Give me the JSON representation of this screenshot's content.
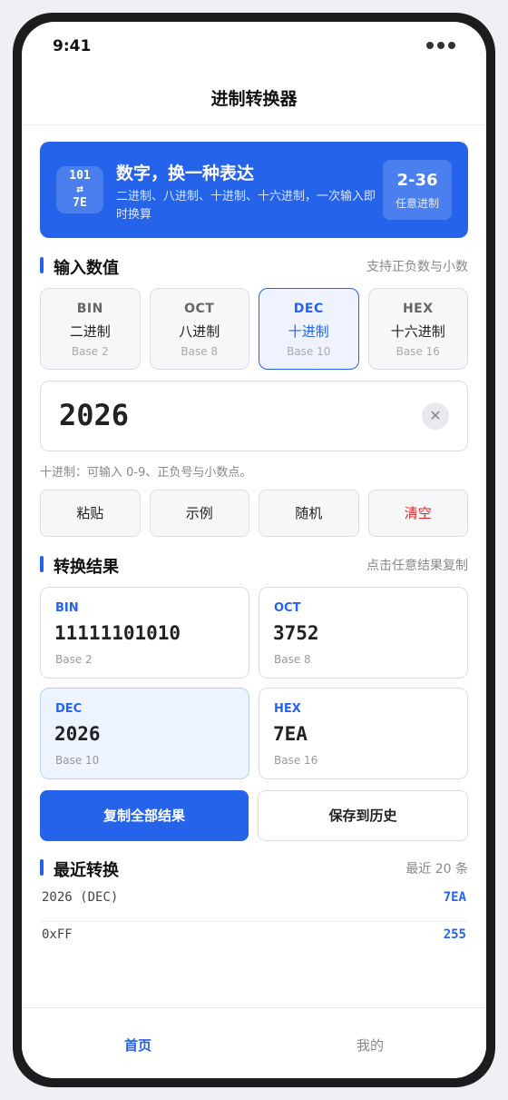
{
  "status": {
    "time": "9:41"
  },
  "navbar": {
    "title": "进制转换器"
  },
  "hero": {
    "badge": {
      "line1": "101",
      "line2": "⇄",
      "line3": "7E"
    },
    "headline": "数字，换一种表达",
    "subtitle": "二进制、八进制、十进制、十六进制，一次输入即时换算",
    "range": {
      "value": "2-36",
      "label": "任意进制"
    }
  },
  "input_section": {
    "title": "输入数值",
    "hint": "支持正负数与小数"
  },
  "bases": [
    {
      "code": "BIN",
      "name": "二进制",
      "base": "Base 2",
      "active": false
    },
    {
      "code": "OCT",
      "name": "八进制",
      "base": "Base 8",
      "active": false
    },
    {
      "code": "DEC",
      "name": "十进制",
      "base": "Base 10",
      "active": true
    },
    {
      "code": "HEX",
      "name": "十六进制",
      "base": "Base 16",
      "active": false
    }
  ],
  "input": {
    "value": "2026",
    "clear_icon": "close-icon"
  },
  "help_text": "十进制：可输入 0-9、正负号与小数点。",
  "actions": {
    "paste": "粘贴",
    "example": "示例",
    "random": "随机",
    "clear": "清空"
  },
  "results_section": {
    "title": "转换结果",
    "hint": "点击任意结果复制"
  },
  "results": [
    {
      "code": "BIN",
      "value": "11111101010",
      "base": "Base 2"
    },
    {
      "code": "OCT",
      "value": "3752",
      "base": "Base 8"
    },
    {
      "code": "DEC",
      "value": "2026",
      "base": "Base 10"
    },
    {
      "code": "HEX",
      "value": "7EA",
      "base": "Base 16"
    }
  ],
  "buttons": {
    "copy_all": "复制全部结果",
    "save_history": "保存到历史"
  },
  "history_section": {
    "title": "最近转换",
    "hint": "最近 20 条"
  },
  "history": [
    {
      "input": "2026 (DEC)",
      "output": "7EA"
    },
    {
      "input": "0xFF",
      "output": "255"
    }
  ],
  "tabbar": {
    "home": "首页",
    "mine": "我的"
  },
  "colors": {
    "accent": "#2563eb",
    "danger": "#dc2626"
  }
}
